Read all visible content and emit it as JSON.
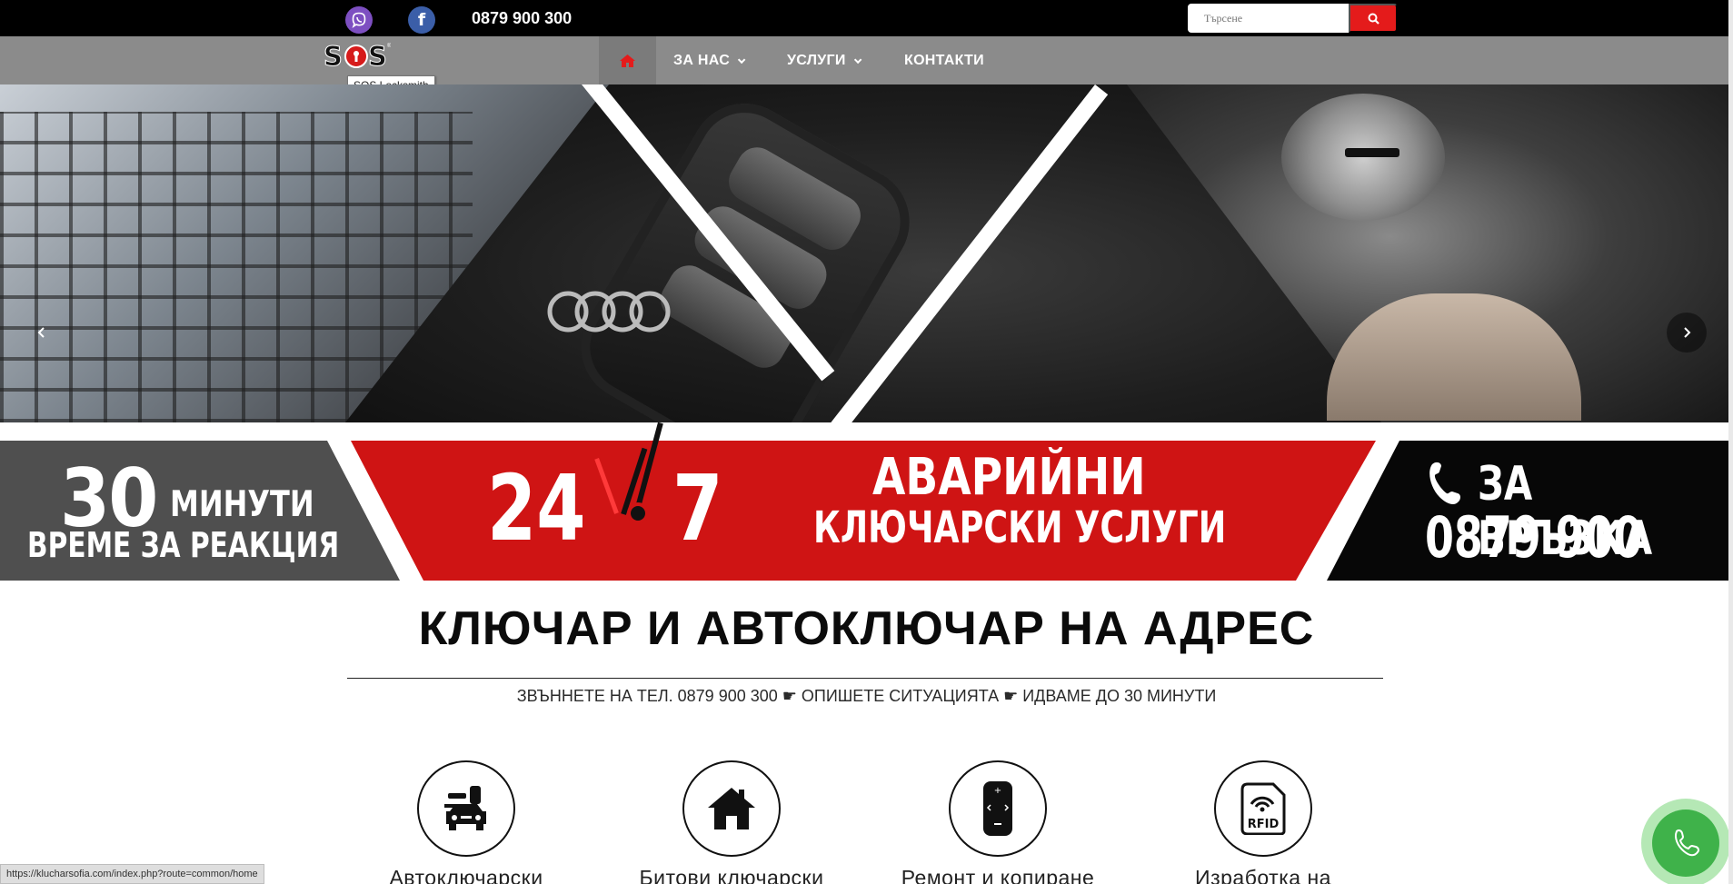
{
  "header": {
    "phone": "0879 900 300",
    "search_placeholder": "Търсене",
    "icons": {
      "viber": "viber-icon",
      "facebook": "facebook-icon",
      "search": "search-icon"
    }
  },
  "nav": {
    "logo_text": "SOS",
    "logo_tooltip": "SOS Locksmith",
    "items": [
      {
        "label": "ЗА НАС"
      },
      {
        "label": "УСЛУГИ"
      },
      {
        "label": "КОНТАКТИ"
      }
    ]
  },
  "banner": {
    "minutes_number": "30",
    "minutes_word": "МИНУТИ",
    "reaction": "ВРЕМЕ ЗА РЕАКЦИЯ",
    "hours": "24",
    "days": "7",
    "emergency": "АВАРИЙНИ",
    "services": "КЛЮЧАРСКИ УСЛУГИ",
    "contact_label": "ЗА ВРЪЗКА",
    "contact_phone": "0879 900 300"
  },
  "main": {
    "title": "КЛЮЧАР И АВТОКЛЮЧАР НА АДРЕС",
    "subtitle": "ЗВЪННЕТЕ НА ТЕЛ. 0879 900 300 ☛ ОПИШЕТЕ СИТУАЦИЯТА ☛ ИДВАМЕ ДО 30 МИНУТИ"
  },
  "services": [
    {
      "label": "Автоключарски",
      "icon": "car-key-icon"
    },
    {
      "label": "Битови ключарски",
      "icon": "home-icon"
    },
    {
      "label": "Ремонт и копиране",
      "icon": "remote-control-icon"
    },
    {
      "label": "Изработка на",
      "icon": "rfid-card-icon"
    }
  ],
  "rfid_text": "RFID",
  "status_url": "https://klucharsofia.com/index.php?route=common/home",
  "colors": {
    "accent": "#e41b1b",
    "nav": "#8b8b8b",
    "banner_red": "#cf1414",
    "call": "#3fb24a"
  }
}
